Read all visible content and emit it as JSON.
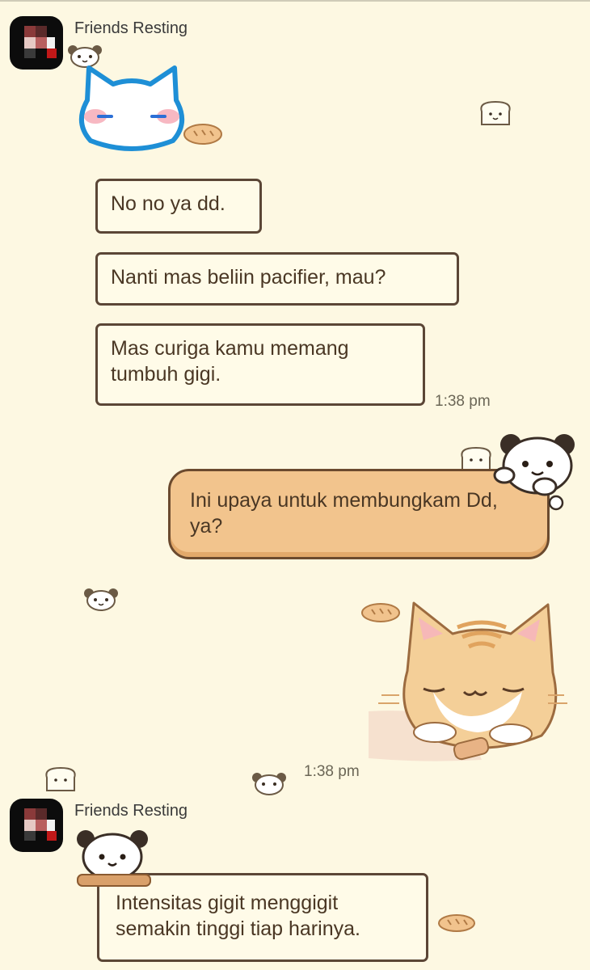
{
  "messages": [
    {
      "sender": "Friends Resting"
    },
    {
      "text": "No no ya dd."
    },
    {
      "text": "Nanti mas beliin pacifier, mau?"
    },
    {
      "text": "Mas curiga kamu memang tumbuh gigi."
    },
    {
      "time": "1:38 pm"
    },
    {
      "text": "Ini upaya untuk membungkam Dd, ya?"
    },
    {
      "time": "1:38 pm"
    },
    {
      "sender": "Friends Resting"
    },
    {
      "text": "Intensitas gigit menggigit semakin tinggi tiap harinya."
    }
  ],
  "stickers": [
    {
      "name": "white-cat-blush-sticker"
    },
    {
      "name": "orange-cat-sleeping-on-hand-sticker"
    }
  ],
  "colors": {
    "background": "#fdf8e2",
    "incoming_bubble": "#fffbe8",
    "outgoing_bubble": "#f2c48d",
    "bubble_border": "#5b4636"
  }
}
